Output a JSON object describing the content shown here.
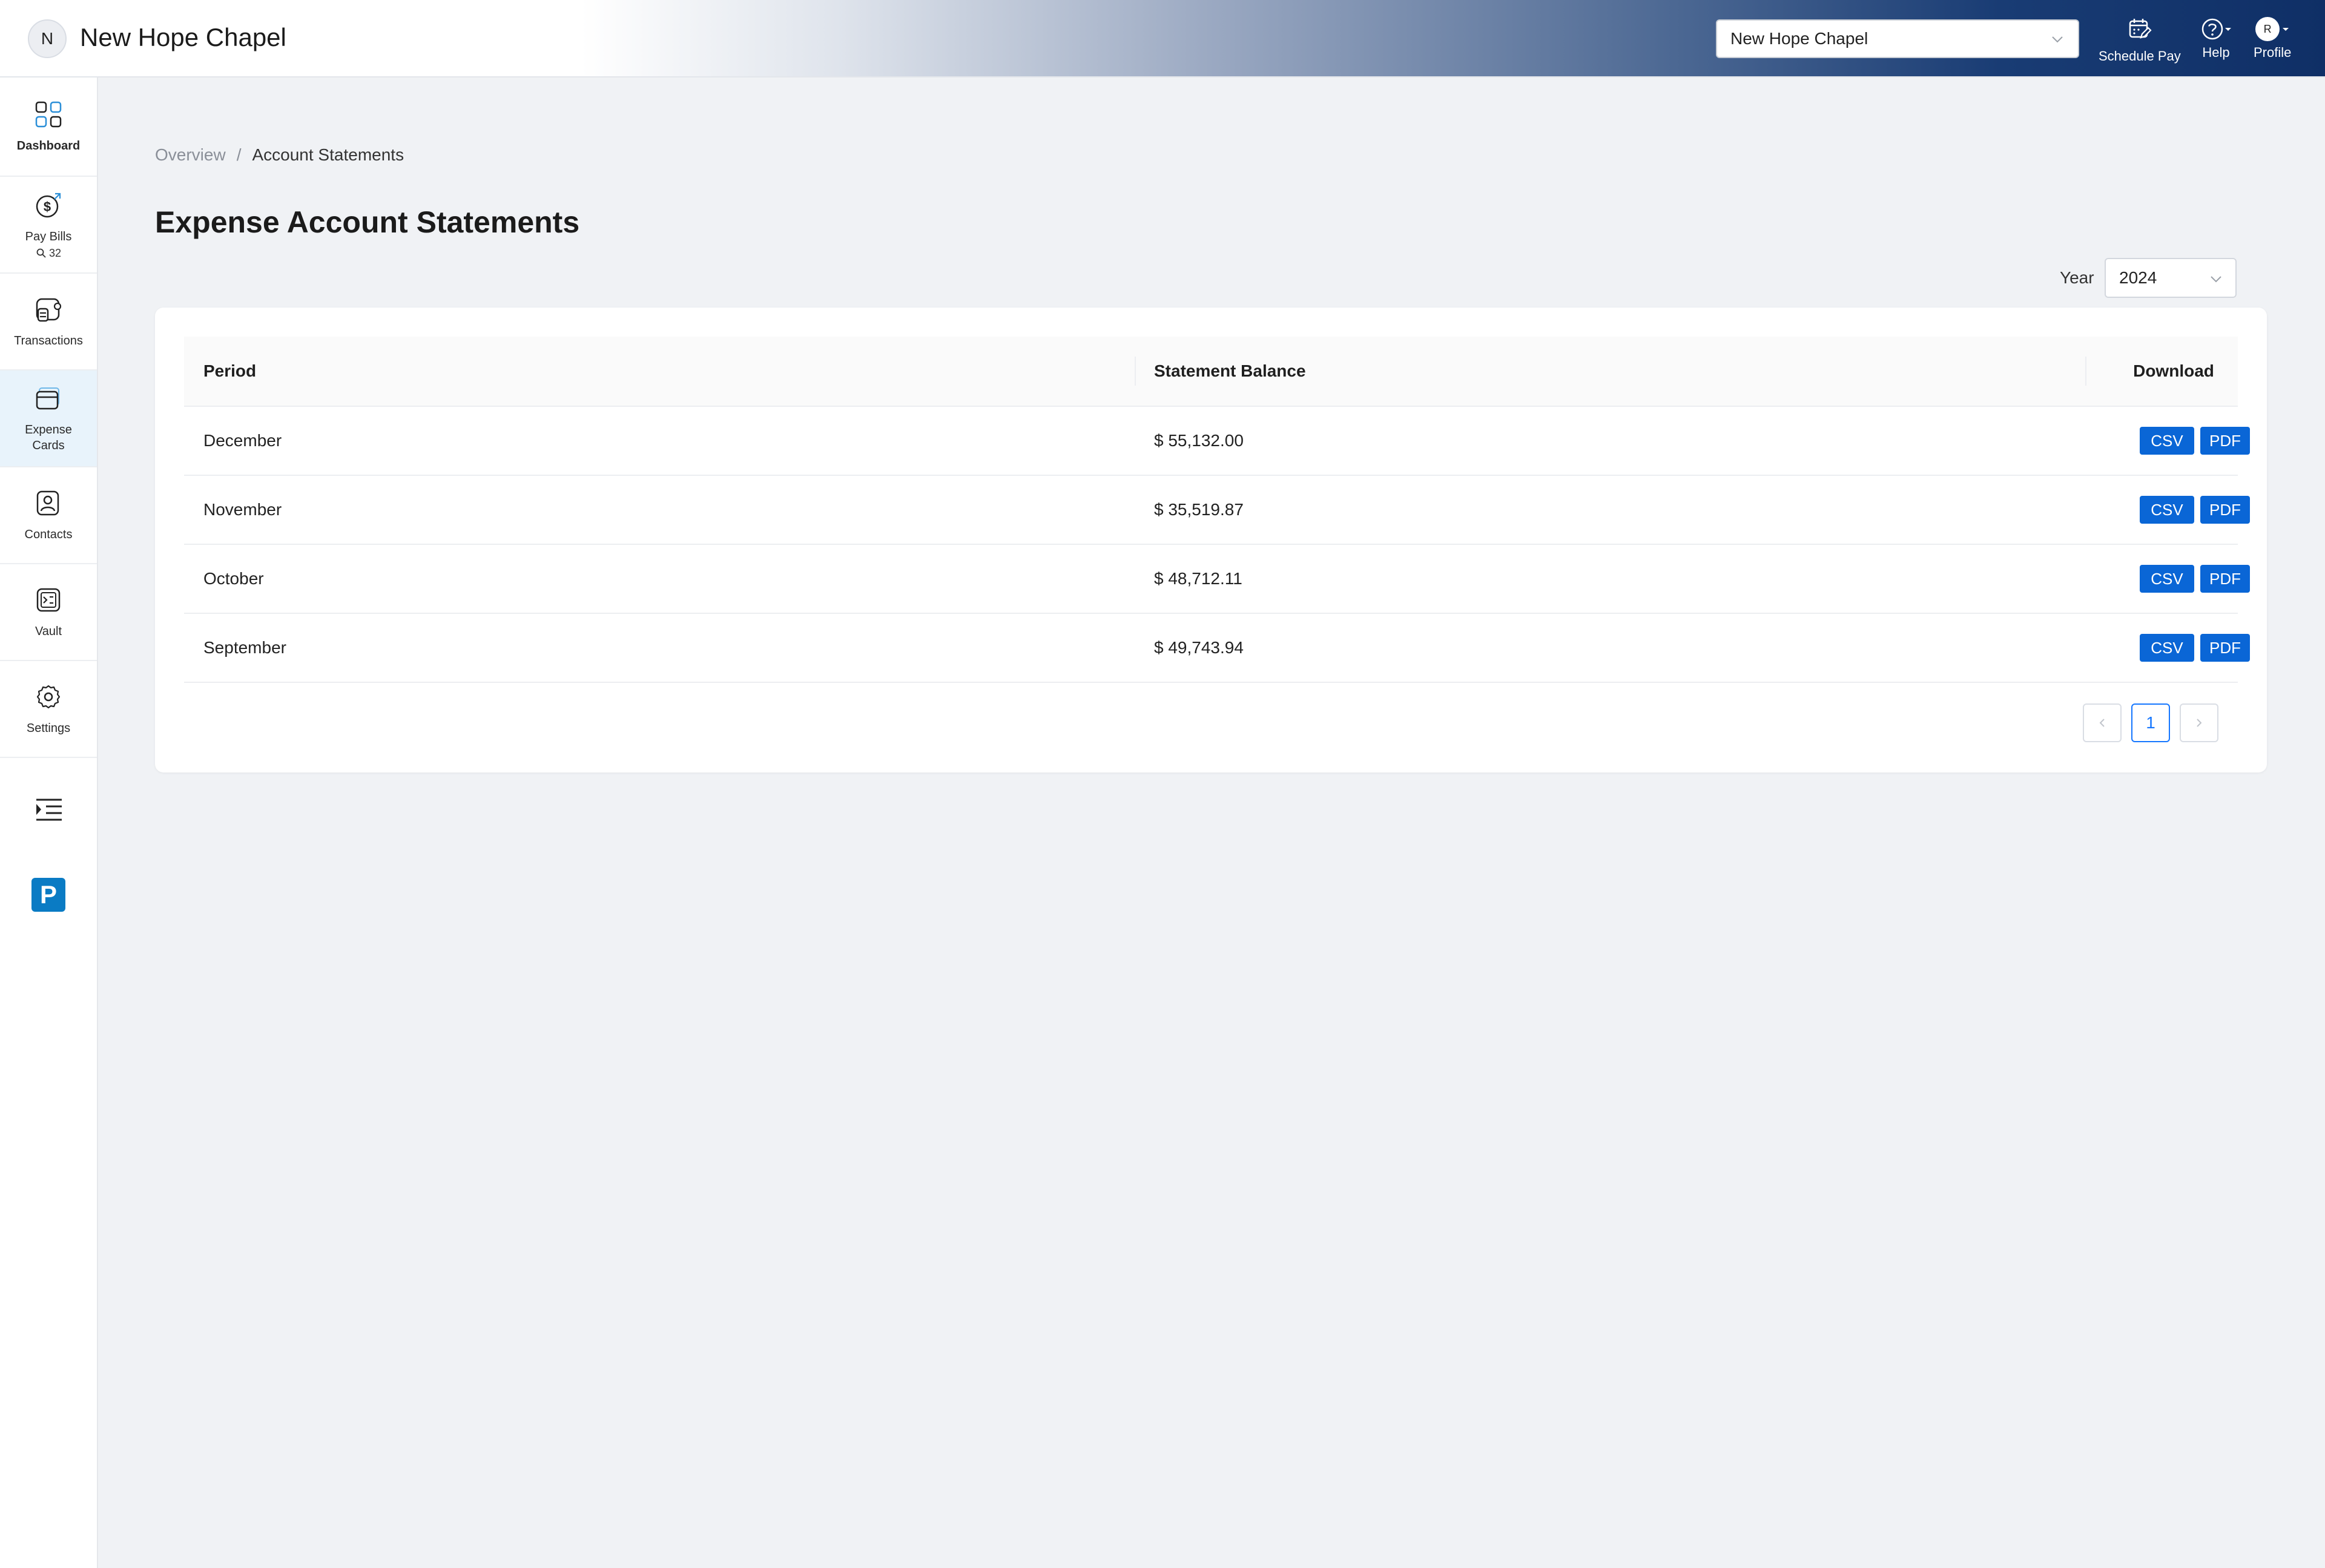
{
  "header": {
    "org_initial": "N",
    "org_name": "New Hope Chapel",
    "org_select_value": "New Hope Chapel",
    "actions": [
      {
        "label": "Schedule Pay",
        "icon": "calendar-edit-icon"
      },
      {
        "label": "Help",
        "icon": "help-circle-icon"
      },
      {
        "label": "Profile",
        "icon": "avatar"
      }
    ],
    "profile_initial": "R"
  },
  "sidebar": {
    "items": [
      {
        "label": "Dashboard",
        "icon": "dashboard-icon"
      },
      {
        "label": "Pay Bills",
        "icon": "dollar-icon",
        "badge": "32"
      },
      {
        "label": "Transactions",
        "icon": "transactions-icon"
      },
      {
        "label": "Expense\nCards",
        "icon": "credit-card-icon",
        "active": true
      },
      {
        "label": "Contacts",
        "icon": "contacts-icon"
      },
      {
        "label": "Vault",
        "icon": "vault-icon"
      },
      {
        "label": "Settings",
        "icon": "gear-icon"
      }
    ],
    "logo_letter": "P"
  },
  "breadcrumb": {
    "parent": "Overview",
    "separator": "/",
    "current": "Account Statements"
  },
  "page": {
    "title": "Expense Account Statements"
  },
  "filter": {
    "year_label": "Year",
    "year_value": "2024"
  },
  "table": {
    "columns": [
      "Period",
      "Statement Balance",
      "Download"
    ],
    "rows": [
      {
        "period": "December",
        "balance": "$ 55,132.00",
        "csv": "CSV",
        "pdf": "PDF"
      },
      {
        "period": "November",
        "balance": "$ 35,519.87",
        "csv": "CSV",
        "pdf": "PDF"
      },
      {
        "period": "October",
        "balance": "$ 48,712.11",
        "csv": "CSV",
        "pdf": "PDF"
      },
      {
        "period": "September",
        "balance": "$ 49,743.94",
        "csv": "CSV",
        "pdf": "PDF"
      }
    ]
  },
  "pagination": {
    "current_page": "1",
    "prev_icon": "chevron-left-icon",
    "next_icon": "chevron-right-icon"
  },
  "colors": {
    "accent": "#0a66d6",
    "header_dark": "#0f2f66",
    "active_nav_bg": "#e8f3fb",
    "page_bg": "#f0f2f5"
  }
}
